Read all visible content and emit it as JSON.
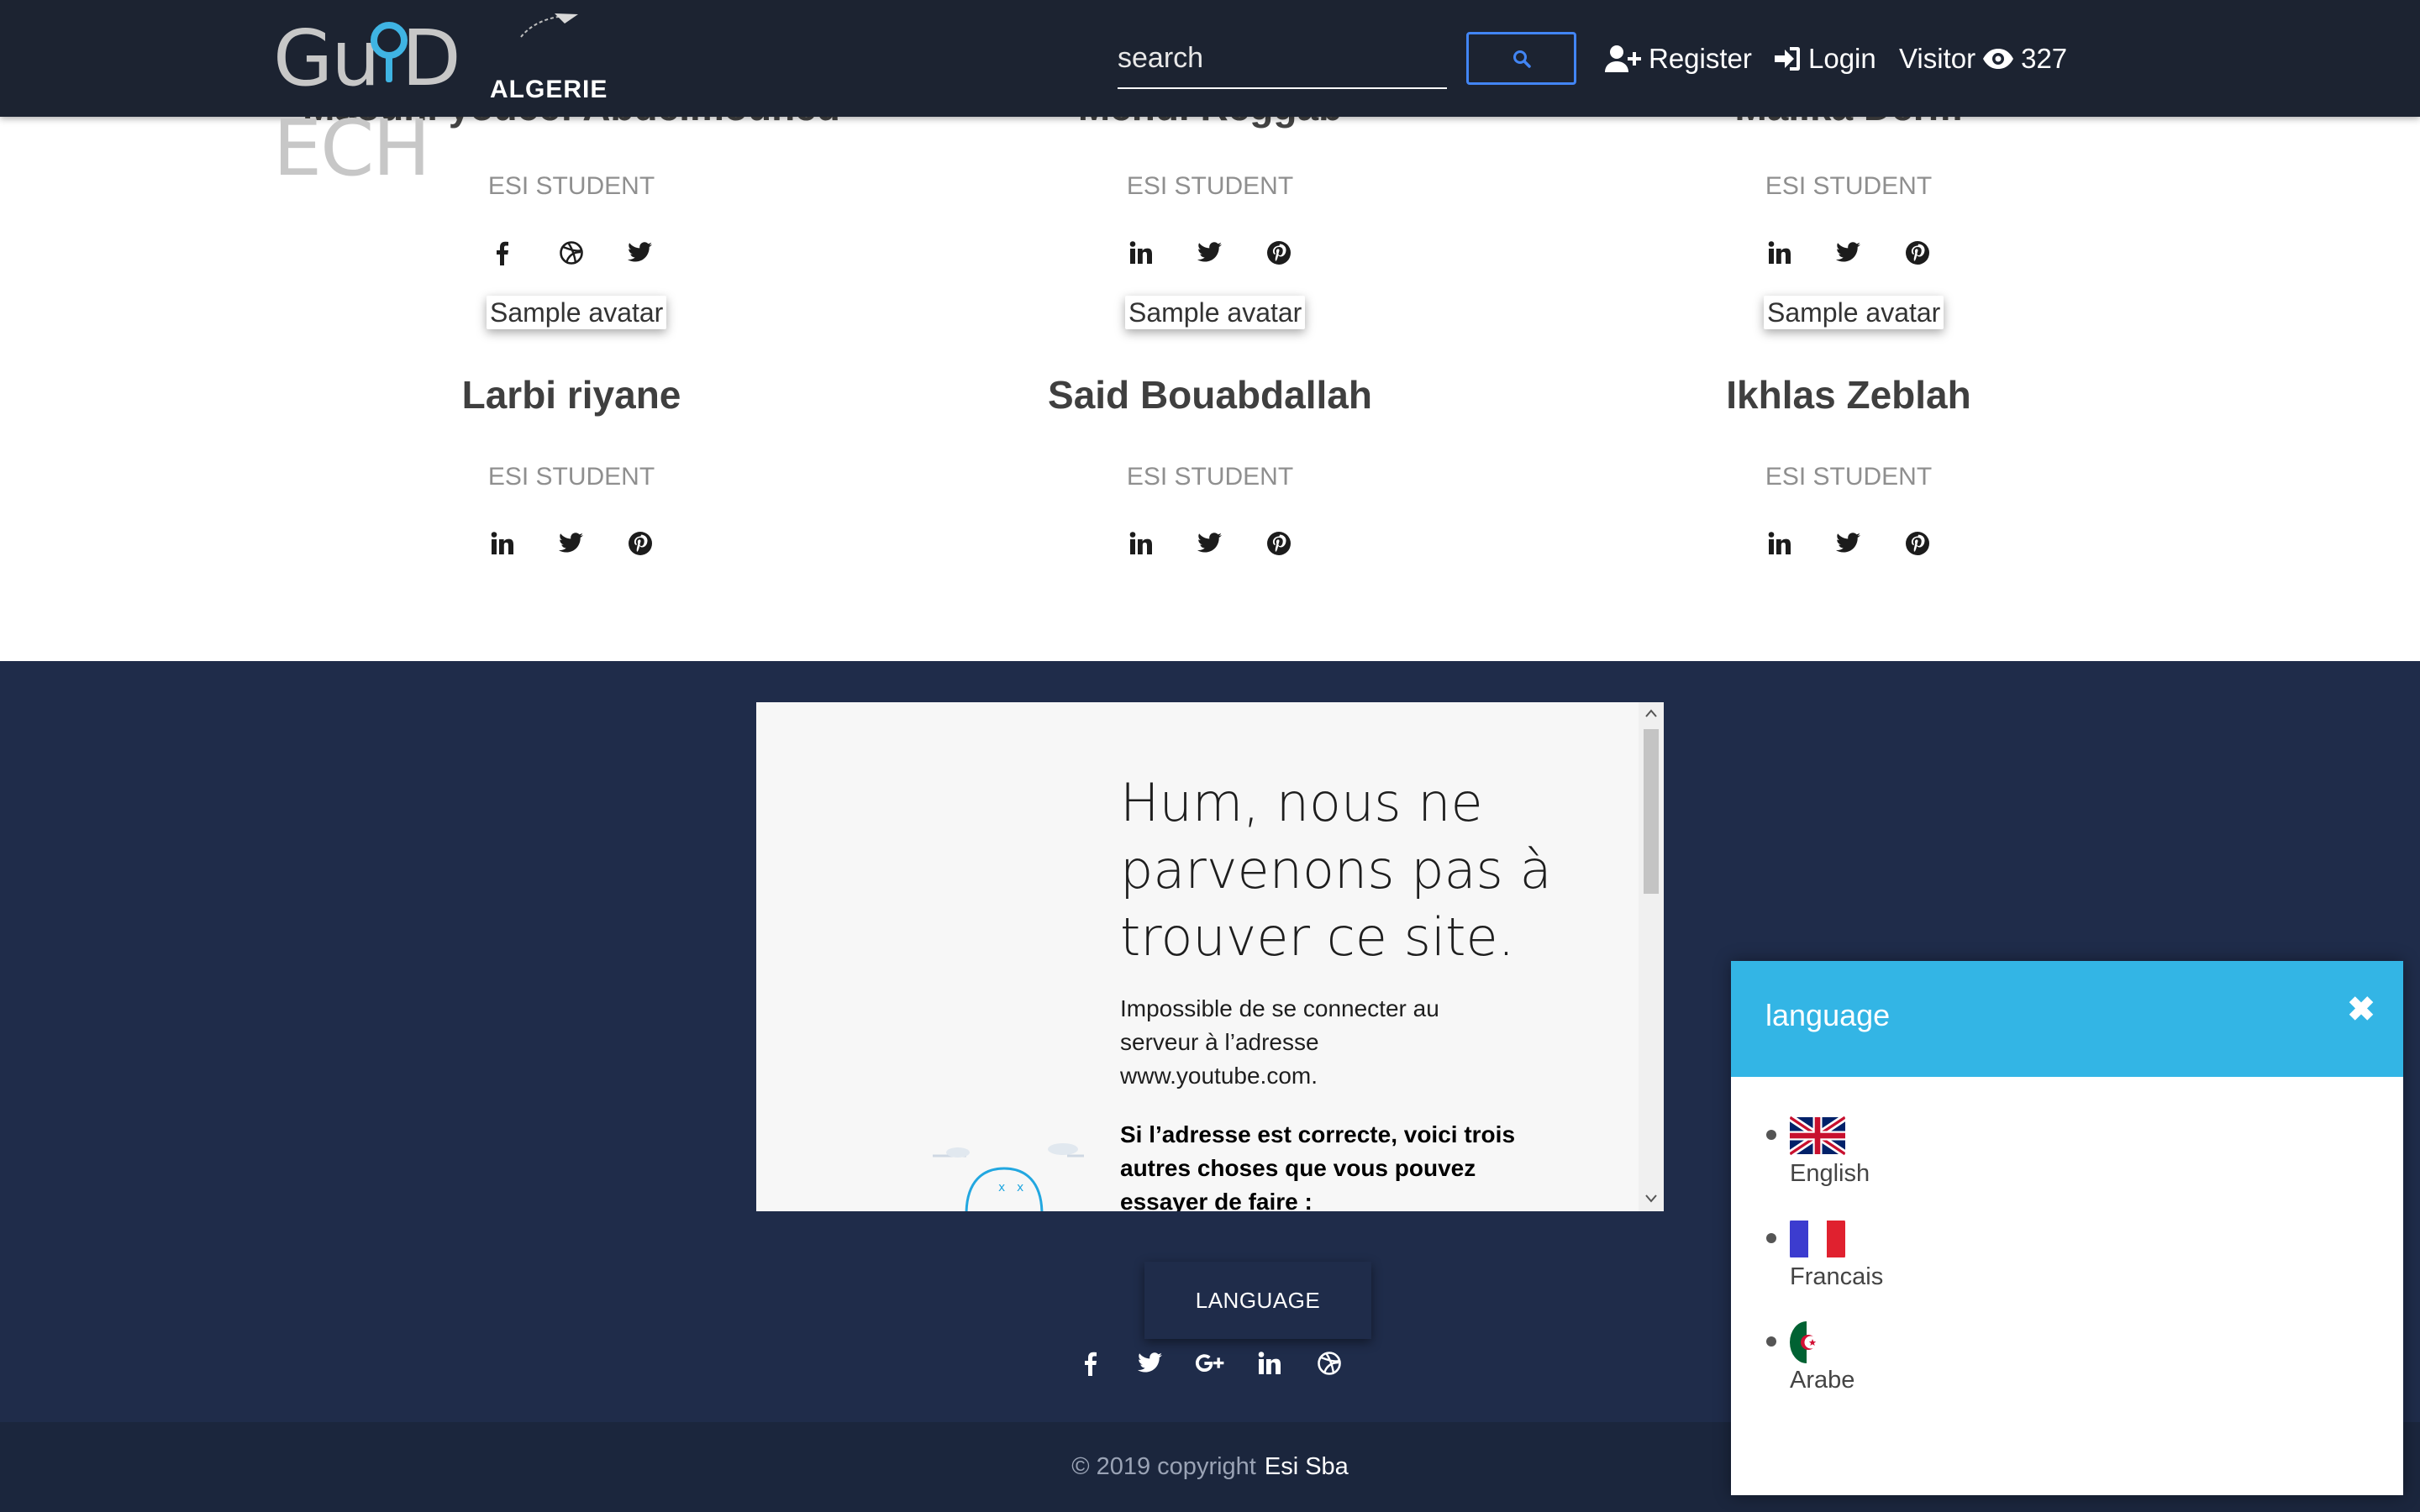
{
  "navbar": {
    "logo_text": "Gu D ECH",
    "logo_sub": "ALGERIE",
    "search_placeholder": "search",
    "register_label": "Register",
    "login_label": "Login",
    "visitor_label": "Visitor",
    "visitor_count": "327"
  },
  "team": {
    "row1": [
      {
        "name": "Maouhi youcef Abdelmouhed",
        "role": "ESI STUDENT",
        "avatar_alt": "Sample avatar",
        "socials": [
          "facebook-icon",
          "dribbble-icon",
          "twitter-icon"
        ]
      },
      {
        "name": "Mehdi Reggab",
        "role": "ESI STUDENT",
        "avatar_alt": "Sample avatar",
        "socials": [
          "linkedin-icon",
          "twitter-icon",
          "pinterest-icon"
        ]
      },
      {
        "name": "Malika Derm",
        "role": "ESI STUDENT",
        "avatar_alt": "Sample avatar",
        "socials": [
          "linkedin-icon",
          "twitter-icon",
          "pinterest-icon"
        ]
      }
    ],
    "row2": [
      {
        "name": "Larbi riyane",
        "role": "ESI STUDENT",
        "socials": [
          "linkedin-icon",
          "twitter-icon",
          "pinterest-icon"
        ]
      },
      {
        "name": "Said Bouabdallah",
        "role": "ESI STUDENT",
        "socials": [
          "linkedin-icon",
          "twitter-icon",
          "pinterest-icon"
        ]
      },
      {
        "name": "Ikhlas Zeblah",
        "role": "ESI STUDENT",
        "socials": [
          "linkedin-icon",
          "twitter-icon",
          "pinterest-icon"
        ]
      }
    ]
  },
  "embed": {
    "title": "Hum, nous ne parvenons pas à trouver ce site.",
    "body": "Impossible de se connecter au serveur à l’adresse www.youtube.com.",
    "bold": "Si l’adresse est correcte, voici trois autres choses que vous pouvez essayer de faire :"
  },
  "footer": {
    "language_button": "LANGUAGE",
    "socials": [
      "facebook-icon",
      "twitter-icon",
      "google-plus-icon",
      "linkedin-icon",
      "dribbble-icon"
    ],
    "copyright": "© 2019 copyright",
    "brand": "Esi Sba"
  },
  "language_panel": {
    "title": "language",
    "items": [
      {
        "label": "English",
        "flag": "uk-flag-icon"
      },
      {
        "label": "Francais",
        "flag": "france-flag-icon"
      },
      {
        "label": "Arabe",
        "flag": "algeria-flag-icon"
      }
    ]
  },
  "colors": {
    "navbar_bg": "#1c2331",
    "footer_bg": "#1f2c4a",
    "panel_header": "#33b5e5",
    "search_button_border": "#4285f4"
  }
}
